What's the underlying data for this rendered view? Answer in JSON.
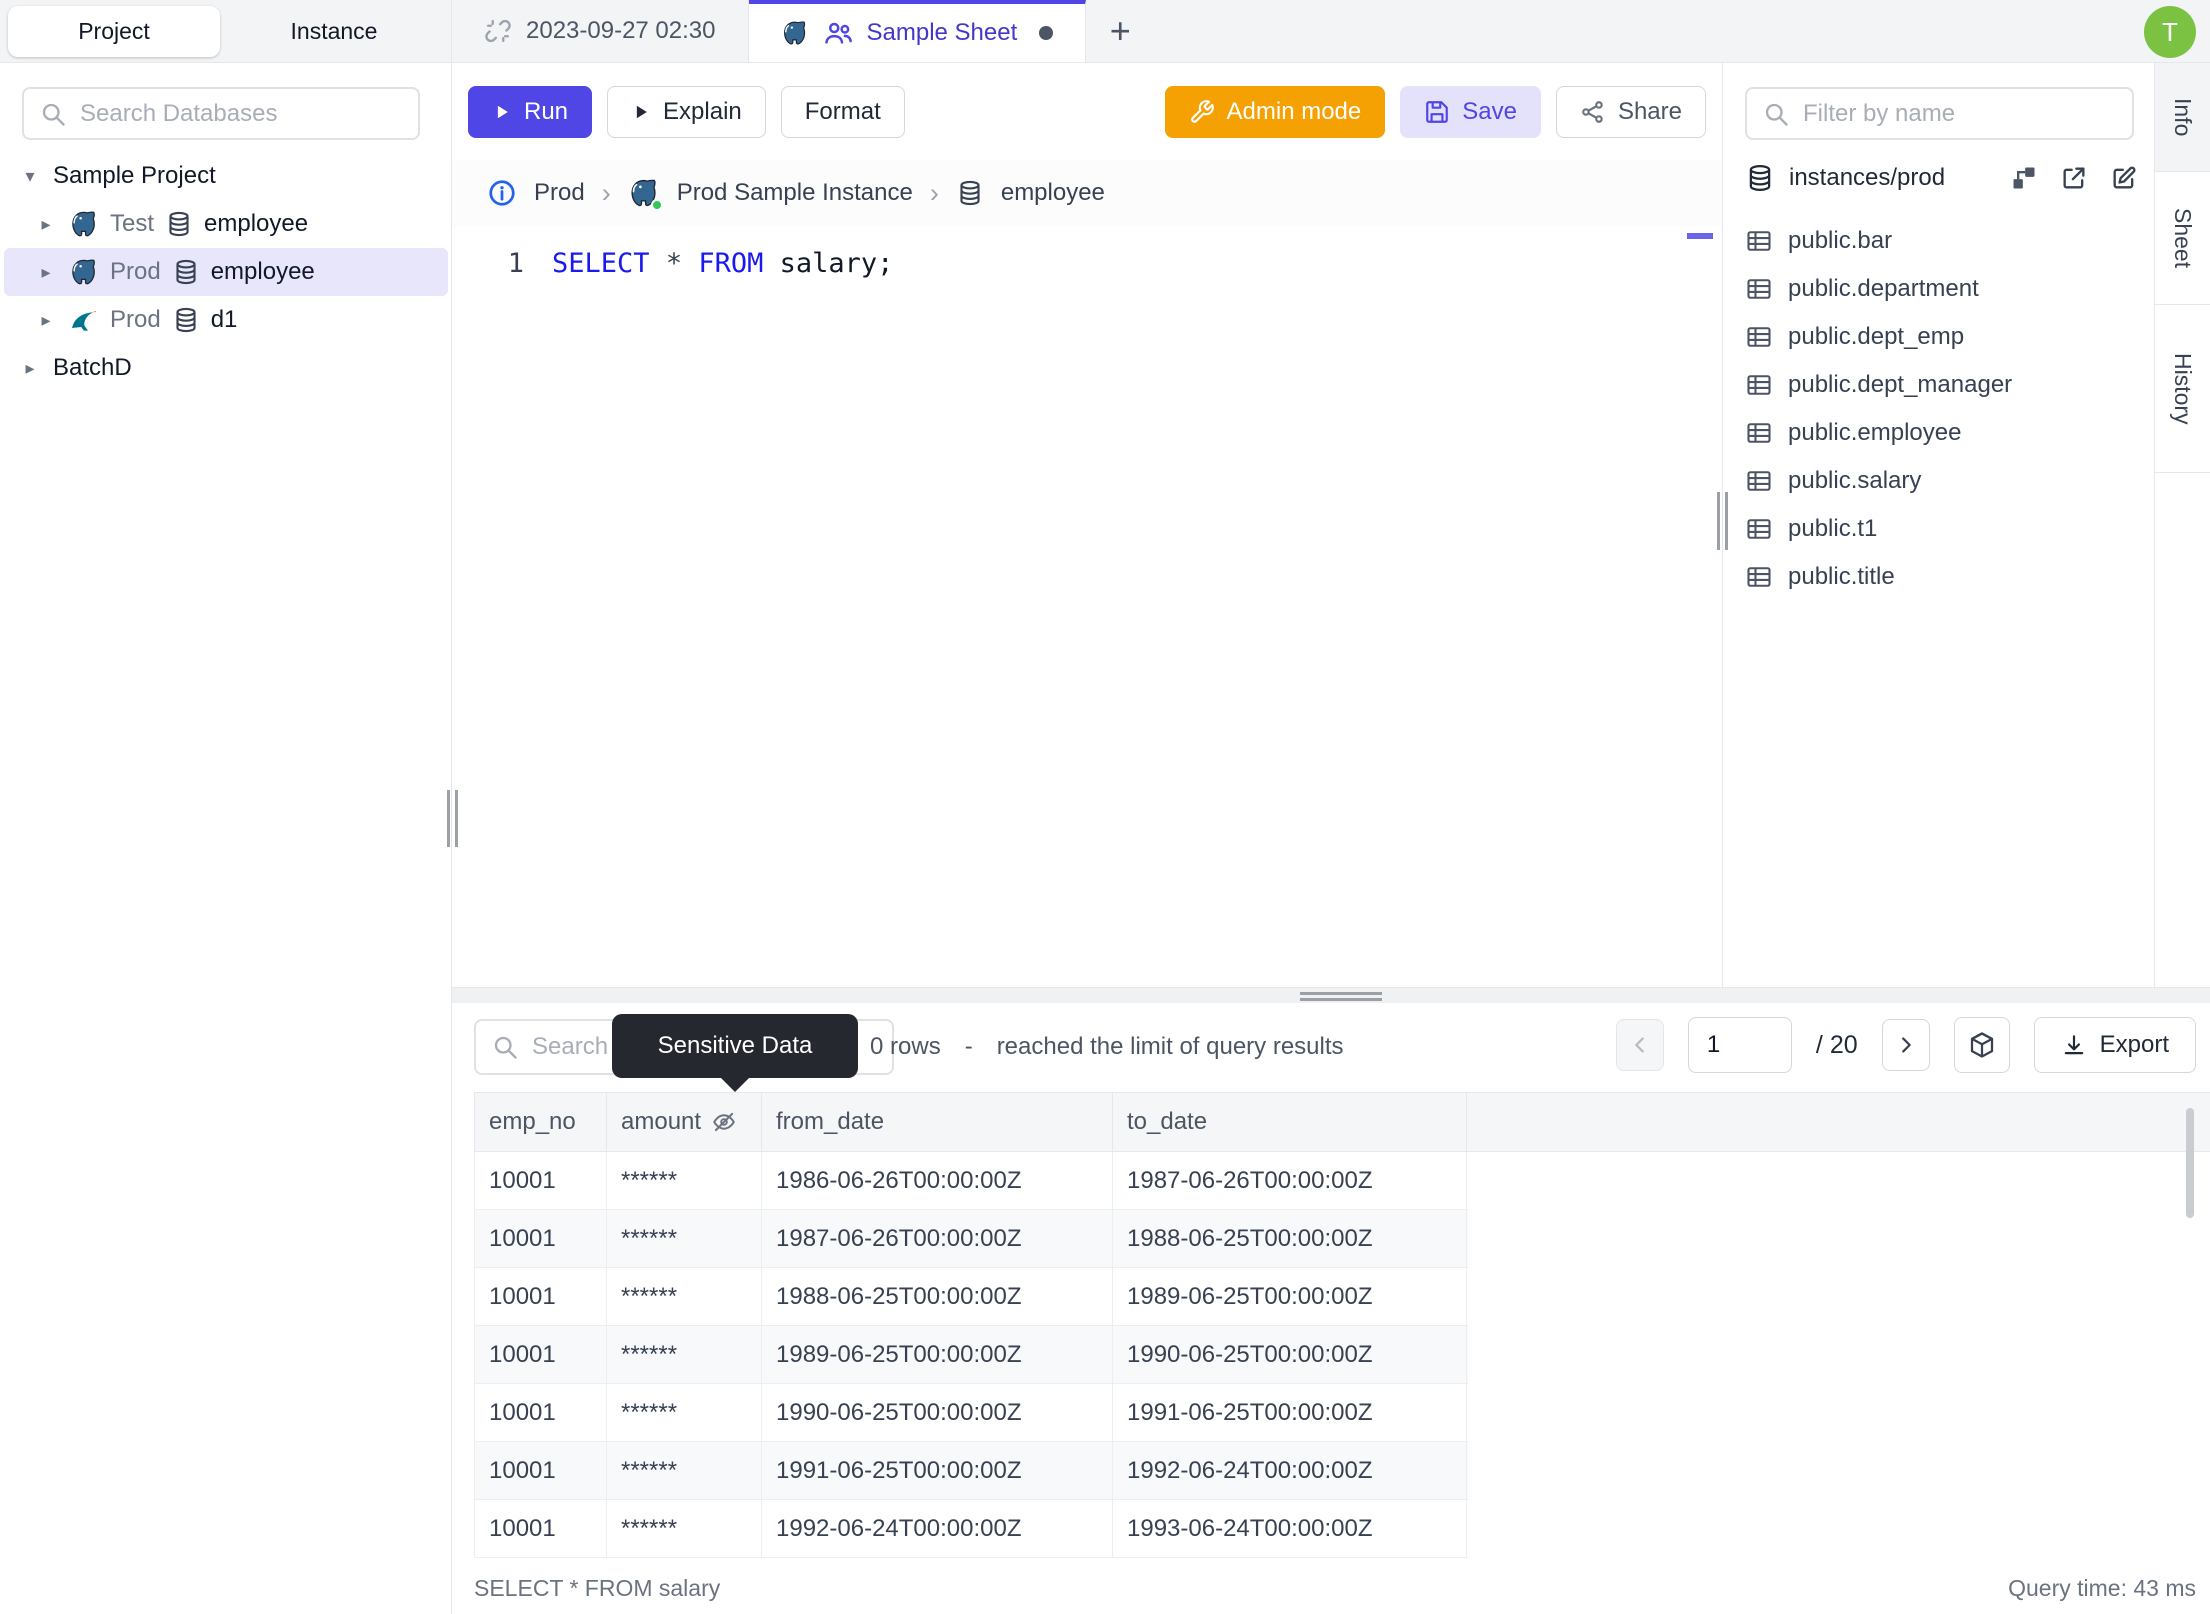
{
  "colors": {
    "accent": "#4f46e5",
    "admin_orange": "#f5a003",
    "avatar_green": "#7cc242",
    "keyword_blue": "#1a1aee",
    "selected_tree_bg": "#e8e6fb",
    "active_tab_border": "#4f46e5"
  },
  "sidebar": {
    "tabs": [
      "Project",
      "Instance"
    ],
    "search_placeholder": "Search Databases",
    "tree": {
      "project": "Sample Project",
      "items": [
        {
          "env": "Test",
          "db": "employee",
          "engine": "postgres"
        },
        {
          "env": "Prod",
          "db": "employee",
          "engine": "postgres"
        },
        {
          "env": "Prod",
          "db": "d1",
          "engine": "mysql"
        }
      ],
      "batch_project": "BatchD"
    }
  },
  "tabbar": {
    "history_tab": "2023-09-27 02:30",
    "active_tab": "Sample Sheet",
    "new_tab": "+"
  },
  "toolbar": {
    "run": "Run",
    "explain": "Explain",
    "format": "Format",
    "admin_mode": "Admin mode",
    "save": "Save",
    "share": "Share"
  },
  "breadcrumb": {
    "environment": "Prod",
    "instance": "Prod Sample Instance",
    "database": "employee",
    "separator": "›"
  },
  "editor": {
    "line_number": "1",
    "keyword_select": "SELECT",
    "operator_star": "*",
    "keyword_from": "FROM",
    "code_tail": "salary;"
  },
  "right_panel": {
    "filter_placeholder": "Filter by name",
    "header": "instances/prod",
    "tables": [
      "public.bar",
      "public.department",
      "public.dept_emp",
      "public.dept_manager",
      "public.employee",
      "public.salary",
      "public.t1",
      "public.title"
    ]
  },
  "side_tabs": {
    "info": "Info",
    "sheet": "Sheet",
    "history": "History"
  },
  "results": {
    "search_placeholder": "Search",
    "tooltip": "Sensitive Data",
    "rows_count": "0 rows",
    "separator": "-",
    "limit_note": "reached the limit of query results",
    "page": "1",
    "page_total": "/ 20",
    "export_label": "Export",
    "columns": [
      "emp_no",
      "amount",
      "from_date",
      "to_date"
    ],
    "rows": [
      [
        "10001",
        "******",
        "1986-06-26T00:00:00Z",
        "1987-06-26T00:00:00Z"
      ],
      [
        "10001",
        "******",
        "1987-06-26T00:00:00Z",
        "1988-06-25T00:00:00Z"
      ],
      [
        "10001",
        "******",
        "1988-06-25T00:00:00Z",
        "1989-06-25T00:00:00Z"
      ],
      [
        "10001",
        "******",
        "1989-06-25T00:00:00Z",
        "1990-06-25T00:00:00Z"
      ],
      [
        "10001",
        "******",
        "1990-06-25T00:00:00Z",
        "1991-06-25T00:00:00Z"
      ],
      [
        "10001",
        "******",
        "1991-06-25T00:00:00Z",
        "1992-06-24T00:00:00Z"
      ],
      [
        "10001",
        "******",
        "1992-06-24T00:00:00Z",
        "1993-06-24T00:00:00Z"
      ]
    ],
    "status_query": "SELECT * FROM salary",
    "status_time": "Query time: 43 ms"
  },
  "user": {
    "initial": "T"
  }
}
